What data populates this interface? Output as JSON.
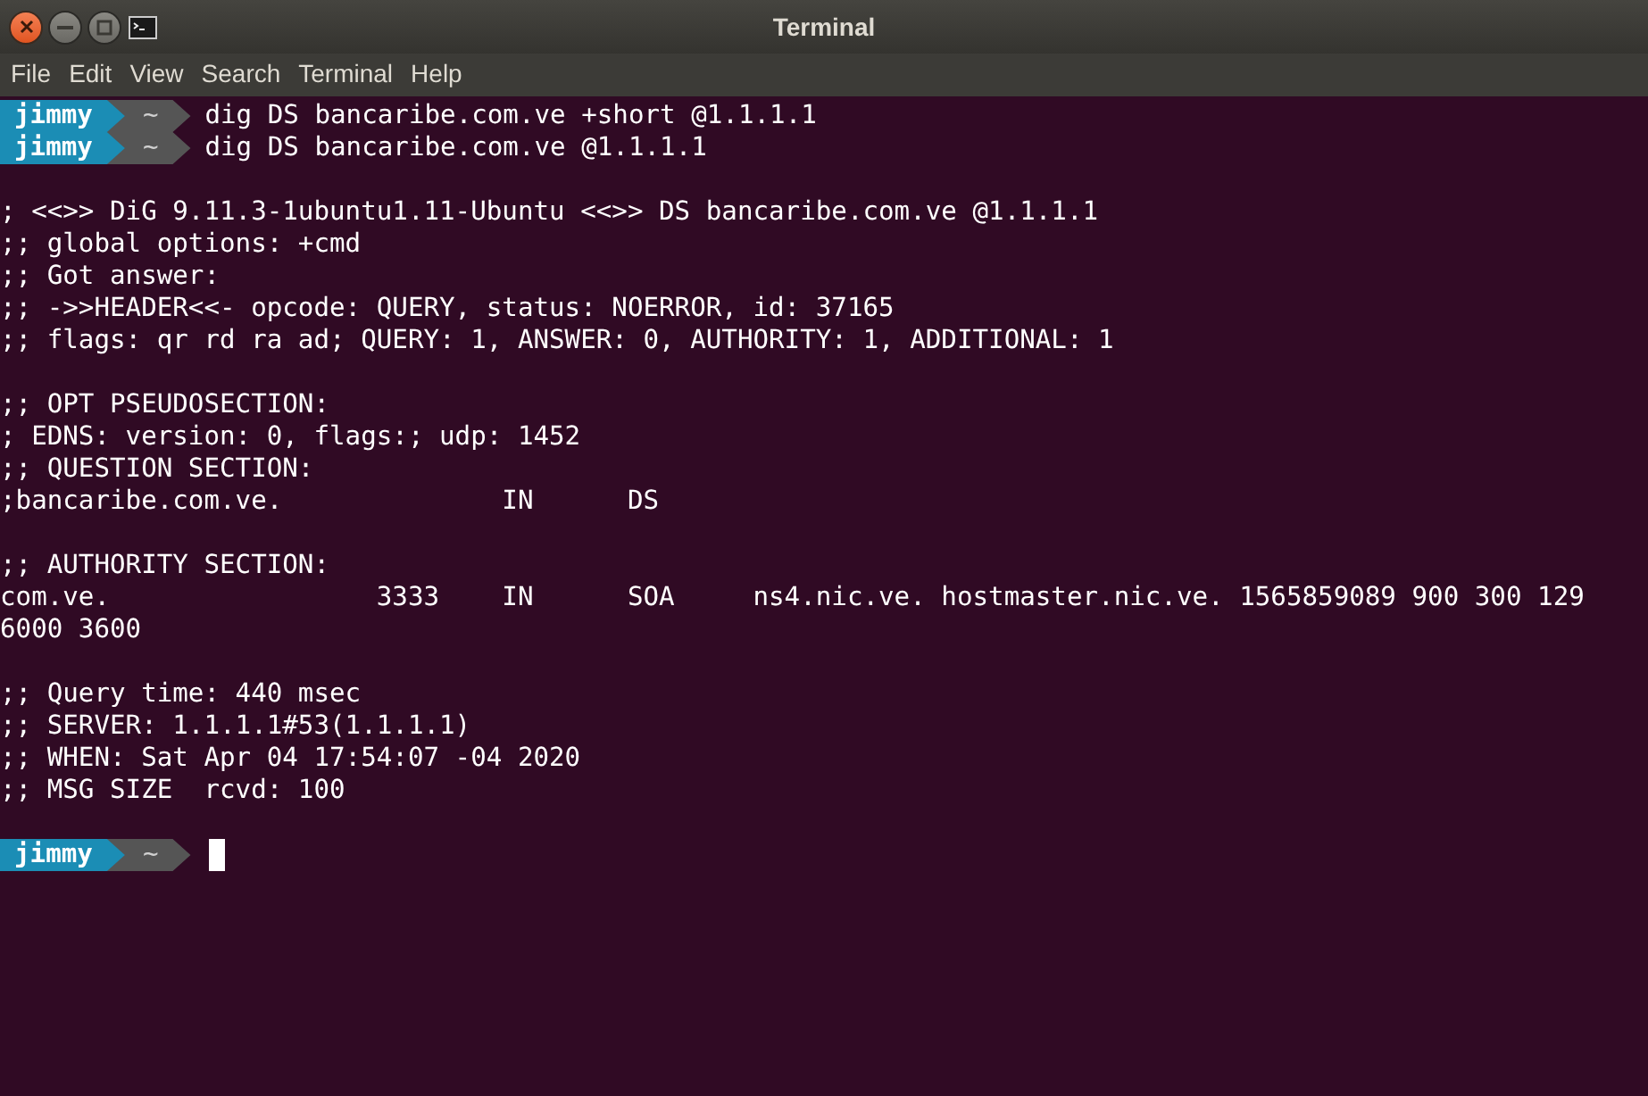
{
  "window": {
    "title": "Terminal"
  },
  "menu": [
    "File",
    "Edit",
    "View",
    "Search",
    "Terminal",
    "Help"
  ],
  "lines": [
    {
      "kind": "prompt",
      "user": "jimmy",
      "dir": "~",
      "command": "dig DS bancaribe.com.ve +short @1.1.1.1"
    },
    {
      "kind": "prompt",
      "user": "jimmy",
      "dir": "~",
      "command": "dig DS bancaribe.com.ve @1.1.1.1"
    },
    {
      "kind": "blank"
    },
    {
      "kind": "output",
      "text": "; <<>> DiG 9.11.3-1ubuntu1.11-Ubuntu <<>> DS bancaribe.com.ve @1.1.1.1"
    },
    {
      "kind": "output",
      "text": ";; global options: +cmd"
    },
    {
      "kind": "output",
      "text": ";; Got answer:"
    },
    {
      "kind": "output",
      "text": ";; ->>HEADER<<- opcode: QUERY, status: NOERROR, id: 37165"
    },
    {
      "kind": "output",
      "text": ";; flags: qr rd ra ad; QUERY: 1, ANSWER: 0, AUTHORITY: 1, ADDITIONAL: 1"
    },
    {
      "kind": "blank"
    },
    {
      "kind": "output",
      "text": ";; OPT PSEUDOSECTION:"
    },
    {
      "kind": "output",
      "text": "; EDNS: version: 0, flags:; udp: 1452"
    },
    {
      "kind": "output",
      "text": ";; QUESTION SECTION:"
    },
    {
      "kind": "output",
      "text": ";bancaribe.com.ve.              IN      DS"
    },
    {
      "kind": "blank"
    },
    {
      "kind": "output",
      "text": ";; AUTHORITY SECTION:"
    },
    {
      "kind": "output",
      "text": "com.ve.                 3333    IN      SOA     ns4.nic.ve. hostmaster.nic.ve. 1565859089 900 300 129"
    },
    {
      "kind": "output",
      "text": "6000 3600"
    },
    {
      "kind": "blank"
    },
    {
      "kind": "output",
      "text": ";; Query time: 440 msec"
    },
    {
      "kind": "output",
      "text": ";; SERVER: 1.1.1.1#53(1.1.1.1)"
    },
    {
      "kind": "output",
      "text": ";; WHEN: Sat Apr 04 17:54:07 -04 2020"
    },
    {
      "kind": "output",
      "text": ";; MSG SIZE  rcvd: 100"
    },
    {
      "kind": "blank"
    },
    {
      "kind": "prompt",
      "user": "jimmy",
      "dir": "~",
      "cursor": true
    }
  ]
}
